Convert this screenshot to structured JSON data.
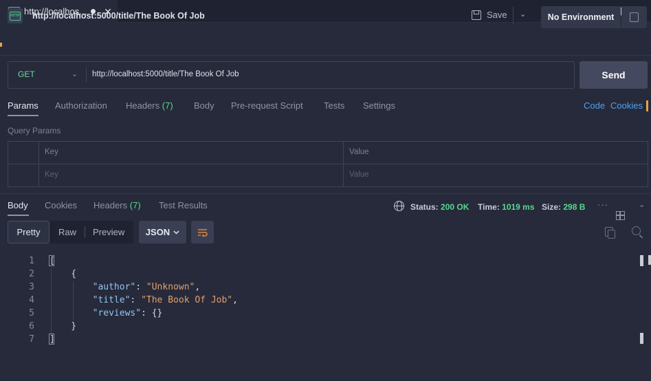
{
  "editor_tab": {
    "icon_text": "HTTP",
    "title": "http://localhos...",
    "close": "✕"
  },
  "request": {
    "title": "http://localhost:5000/title/The Book Of Job",
    "save_label": "Save",
    "environment": "No Environment",
    "method": "GET",
    "url": "http://localhost:5000/title/The Book Of Job",
    "send_label": "Send"
  },
  "request_tabs": [
    {
      "label": "Params",
      "count": ""
    },
    {
      "label": "Authorization",
      "count": ""
    },
    {
      "label": "Headers",
      "count": "(7)"
    },
    {
      "label": "Body",
      "count": ""
    },
    {
      "label": "Pre-request Script",
      "count": ""
    },
    {
      "label": "Tests",
      "count": ""
    },
    {
      "label": "Settings",
      "count": ""
    }
  ],
  "request_links": [
    "Code",
    "Cookies"
  ],
  "query_params": {
    "label": "Query Params",
    "headers": [
      "Key",
      "Value"
    ],
    "placeholders": [
      "Key",
      "Value"
    ]
  },
  "response_tabs": [
    {
      "label": "Body",
      "count": ""
    },
    {
      "label": "Cookies",
      "count": ""
    },
    {
      "label": "Headers",
      "count": "(7)"
    },
    {
      "label": "Test Results",
      "count": ""
    }
  ],
  "response_meta": {
    "status_label": "Status:",
    "status": "200 OK",
    "time_label": "Time:",
    "time": "1019 ms",
    "size_label": "Size:",
    "size": "298 B"
  },
  "format": {
    "modes": [
      "Pretty",
      "Raw",
      "Preview"
    ],
    "language": "JSON"
  },
  "code_lines": [
    {
      "n": "1",
      "text": "["
    },
    {
      "n": "2",
      "text": "    {"
    },
    {
      "n": "3",
      "key": "\"author\"",
      "value": "\"Unknown\"",
      "suffix": ","
    },
    {
      "n": "4",
      "key": "\"title\"",
      "value": "\"The Book Of Job\"",
      "suffix": ","
    },
    {
      "n": "5",
      "key": "\"reviews\"",
      "value": "{}",
      "suffix": ""
    },
    {
      "n": "6",
      "text": "    }"
    },
    {
      "n": "7",
      "text": "]"
    }
  ],
  "colors": {
    "accent_green": "#57d98d",
    "link_blue": "#4ea3f0",
    "json_key": "#8fc6f0",
    "json_string": "#e3a06b",
    "background": "#262a3b"
  }
}
